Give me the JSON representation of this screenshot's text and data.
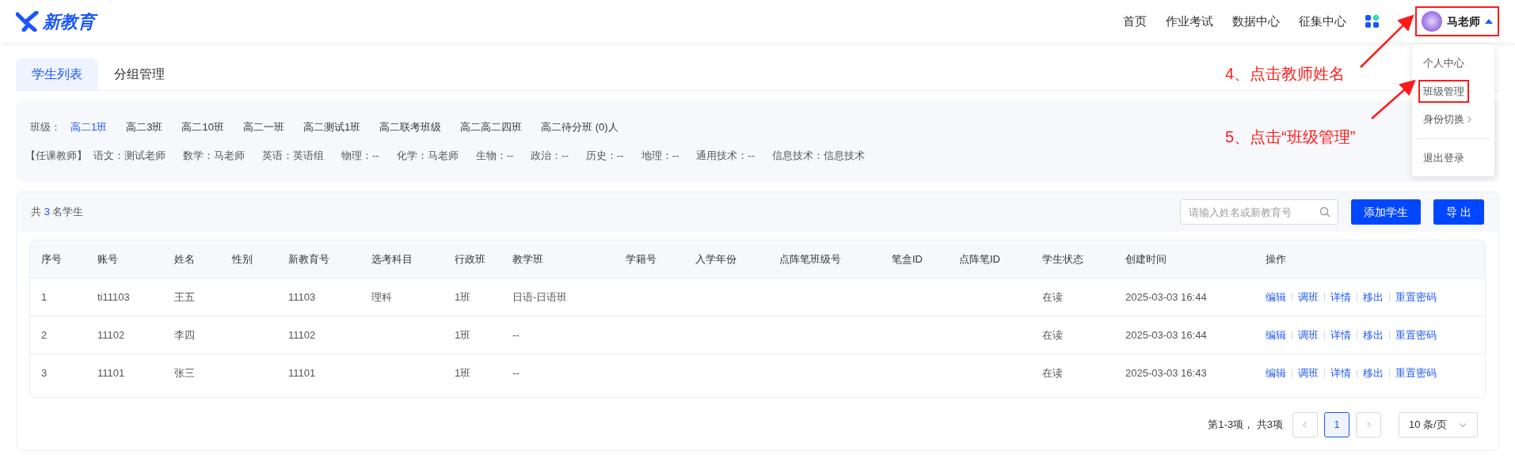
{
  "header": {
    "logo_text": "新教育",
    "nav": [
      "首页",
      "作业考试",
      "数据中心",
      "征集中心"
    ],
    "user": {
      "name": "马老师",
      "menu_open": true,
      "highlighted": true
    }
  },
  "user_menu": [
    {
      "label": "个人中心",
      "kind": "item",
      "highlighted": false
    },
    {
      "label": "班级管理",
      "kind": "item",
      "highlighted": true
    },
    {
      "label": "身份切换",
      "kind": "submenu",
      "highlighted": false
    },
    {
      "label": "退出登录",
      "kind": "logout",
      "highlighted": false
    }
  ],
  "tabs": [
    {
      "label": "学生列表",
      "selected": true
    },
    {
      "label": "分组管理",
      "selected": false
    }
  ],
  "classes": {
    "label": "班级：",
    "items": [
      {
        "label": "高二1班",
        "selected": true
      },
      {
        "label": "高二3班",
        "selected": false
      },
      {
        "label": "高二10班",
        "selected": false
      },
      {
        "label": "高二一班",
        "selected": false
      },
      {
        "label": "高二测试1班",
        "selected": false
      },
      {
        "label": "高二联考班级",
        "selected": false
      },
      {
        "label": "高二高二四班",
        "selected": false
      },
      {
        "label": "高二待分班 (0)人",
        "selected": false
      }
    ]
  },
  "teachers": {
    "label": "【任课教师】",
    "items": [
      "语文：测试老师",
      "数学：马老师",
      "英语：英语组",
      "物理：--",
      "化学：马老师",
      "生物：--",
      "政治：--",
      "历史：--",
      "地理：--",
      "通用技术：--",
      "信息技术：信息技术"
    ]
  },
  "students": {
    "count_prefix": "共",
    "count": "3",
    "count_suffix": "名学生",
    "search": {
      "placeholder": "请输入姓名或新教育号"
    },
    "buttons": [
      "添加学生",
      "导 出"
    ],
    "table": {
      "columns": [
        "序号",
        "账号",
        "姓名",
        "性别",
        "新教育号",
        "选考科目",
        "行政班",
        "教学班",
        "学籍号",
        "入学年份",
        "点阵笔班级号",
        "笔盒ID",
        "点阵笔ID",
        "学生状态",
        "创建时间",
        "操作"
      ],
      "rows": [
        {
          "cells": [
            "1",
            "ti11103",
            "王五",
            "",
            "11103",
            "理科",
            "1班",
            "日语-日语班",
            "",
            "",
            "",
            "",
            "",
            "在读",
            "2025-03-03 16:44"
          ],
          "actions": [
            "编辑",
            "调班",
            "详情",
            "移出",
            "重置密码"
          ]
        },
        {
          "cells": [
            "2",
            "11102",
            "李四",
            "",
            "11102",
            "",
            "1班",
            "--",
            "",
            "",
            "",
            "",
            "",
            "在读",
            "2025-03-03 16:44"
          ],
          "actions": [
            "编辑",
            "调班",
            "详情",
            "移出",
            "重置密码"
          ]
        },
        {
          "cells": [
            "3",
            "11101",
            "张三",
            "",
            "11101",
            "",
            "1班",
            "--",
            "",
            "",
            "",
            "",
            "",
            "在读",
            "2025-03-03 16:43"
          ],
          "actions": [
            "编辑",
            "调班",
            "详情",
            "移出",
            "重置密码"
          ]
        }
      ]
    },
    "pagination": {
      "summary": "第1-3项， 共3项",
      "pages": [
        {
          "label": "1",
          "selected": true
        }
      ],
      "page_size": "10 条/页"
    }
  },
  "annotations": [
    {
      "text": "4、点击教师姓名"
    },
    {
      "text": "5、点击“班级管理”"
    }
  ]
}
